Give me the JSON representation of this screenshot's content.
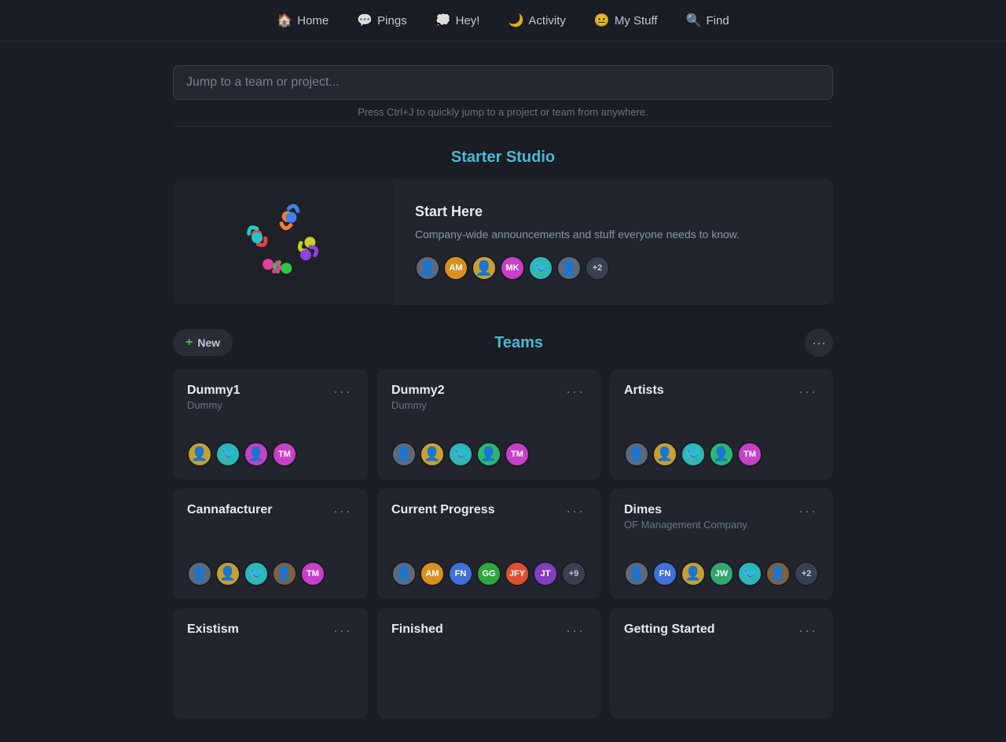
{
  "nav": {
    "items": [
      {
        "id": "home",
        "label": "Home",
        "icon": "🏠"
      },
      {
        "id": "pings",
        "label": "Pings",
        "icon": "💬"
      },
      {
        "id": "hey",
        "label": "Hey!",
        "icon": "💭"
      },
      {
        "id": "activity",
        "label": "Activity",
        "icon": "🌙"
      },
      {
        "id": "mystuff",
        "label": "My Stuff",
        "icon": "😐"
      },
      {
        "id": "find",
        "label": "Find",
        "icon": "🔍"
      }
    ]
  },
  "search": {
    "placeholder": "Jump to a team or project...",
    "hint": "Press Ctrl+J to quickly jump to a project or team from anywhere."
  },
  "starter_studio": {
    "title": "Starter Studio",
    "project": {
      "name": "Start Here",
      "description": "Company-wide announcements and stuff everyone needs to know.",
      "member_count_extra": "+2"
    }
  },
  "teams": {
    "title": "Teams",
    "new_label": "New",
    "cards": [
      {
        "id": "dummy1",
        "name": "Dummy1",
        "sub": "Dummy",
        "members": [
          "av-gold",
          "av-teal",
          "av-magenta",
          "TM"
        ]
      },
      {
        "id": "dummy2",
        "name": "Dummy2",
        "sub": "Dummy",
        "members": [
          "av-gray",
          "av-gold",
          "av-teal",
          "av-green",
          "TM"
        ]
      },
      {
        "id": "artists",
        "name": "Artists",
        "sub": "",
        "members": [
          "av-gray",
          "av-gold",
          "av-teal",
          "av-green",
          "TM"
        ]
      },
      {
        "id": "cannafacturer",
        "name": "Cannafacturer",
        "sub": "",
        "members": [
          "av-gray",
          "av-gold",
          "av-teal",
          "av-brown",
          "TM"
        ]
      },
      {
        "id": "current-progress",
        "name": "Current Progress",
        "sub": "",
        "members": [
          "av-gray",
          "AM",
          "FN",
          "GG",
          "JFY",
          "JT",
          "+9"
        ]
      },
      {
        "id": "dimes",
        "name": "Dimes",
        "sub": "OF Management Company",
        "members": [
          "av-gray",
          "FN",
          "av-gold",
          "JW",
          "av-teal",
          "av-brown",
          "+2"
        ]
      },
      {
        "id": "existism",
        "name": "Existism",
        "sub": "",
        "members": []
      },
      {
        "id": "finished",
        "name": "Finished",
        "sub": "",
        "members": []
      },
      {
        "id": "getting-started",
        "name": "Getting Started",
        "sub": "",
        "members": []
      }
    ]
  }
}
